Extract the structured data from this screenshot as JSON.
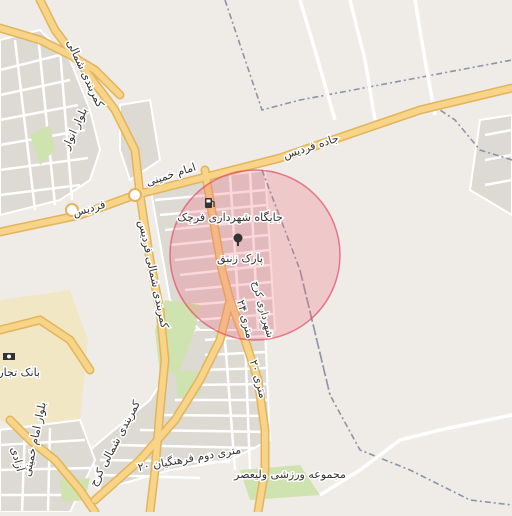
{
  "map": {
    "colors": {
      "background": "#efece7",
      "block": "#ddd9d3",
      "street": "#ffffff",
      "primary_road": "#f7d488",
      "primary_casing": "#e2b45c",
      "park": "#cfe3b0",
      "sand": "#f1e7c4",
      "boundary": "#8d93a8",
      "radius_fill": "#f06d7f",
      "radius_stroke": "#e24c64",
      "label": "#333333"
    },
    "labels": {
      "road_fardis_east": "جاده فردیس",
      "road_khomeini_north": "امام خمینی",
      "road_fardis_west": "فردیس",
      "road_kamarbandi_west": "کمربندی شمالی",
      "road_kamarbandi_central": "کمربندی شمالی فردیس",
      "road_kamarbandi_south": "کمربندی شمالی کرج",
      "road_anvar": "بلوار انوار",
      "road_azadi": "آزادی",
      "road_khomeini_blvd": "بلوار امام خمینی",
      "road_20m": "۲۰ متری",
      "road_24m": "۲۴ متری",
      "road_20m_farhangian": "۲۰ متری دوم فرهنگیان",
      "street_karaj": "شهرداری کرج",
      "poi_fuel_station": "جایگاه شهرداری فرچک",
      "poi_park": "پارک زنبق",
      "poi_bank": "بانک تجارت",
      "poi_sports": "مجموعه ورزشی ولیعصر"
    },
    "icons": {
      "fuel": "fuel-icon",
      "park": "tree-icon",
      "bank": "bank-icon"
    }
  }
}
